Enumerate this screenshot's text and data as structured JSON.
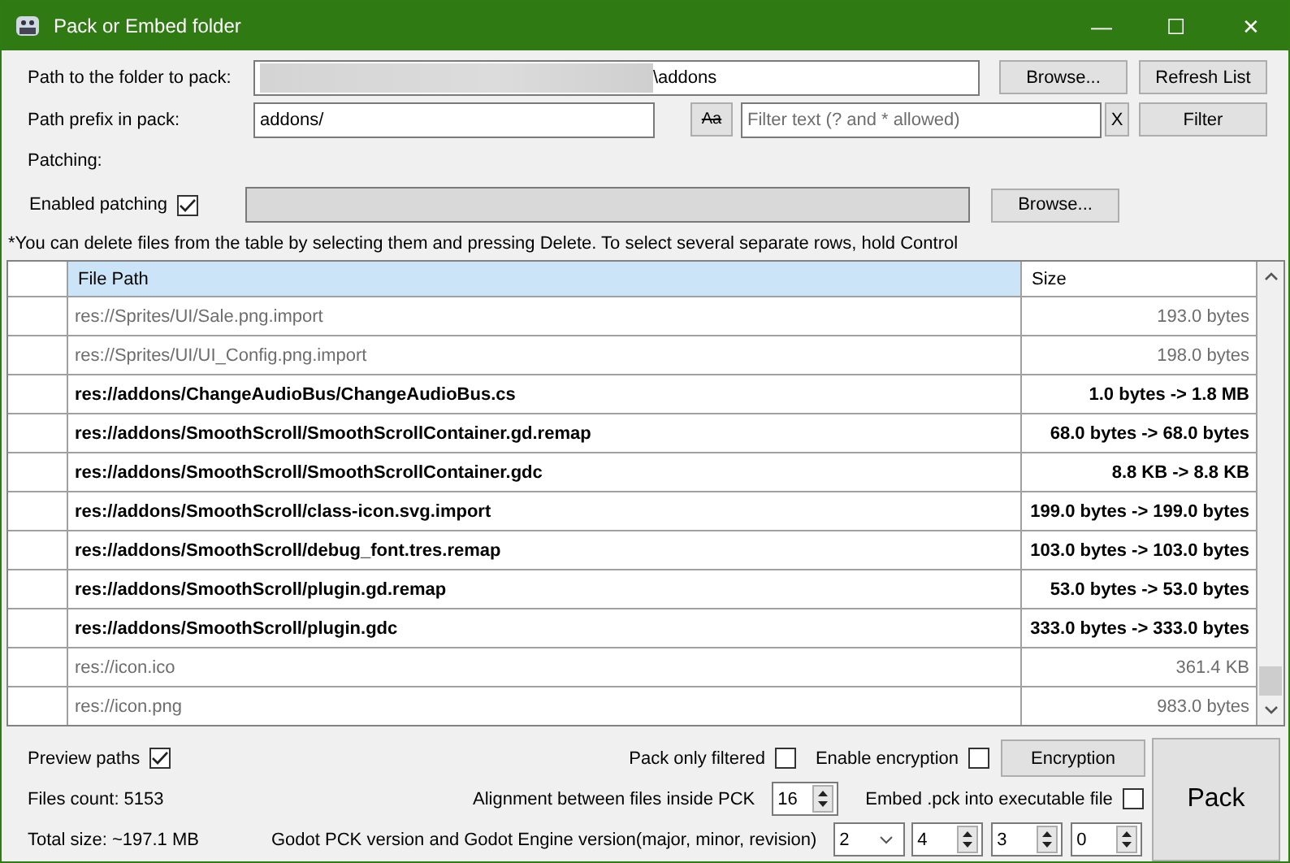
{
  "window": {
    "title": "Pack or Embed folder",
    "controls": [
      "—",
      "☐",
      "✕"
    ]
  },
  "folder": {
    "label": "Path to the folder to pack:",
    "value": "\\addons",
    "browse": "Browse...",
    "refresh": "Refresh List"
  },
  "prefix": {
    "label": "Path prefix in pack:",
    "value": "addons/",
    "case_button": "Aa",
    "filter_placeholder": "Filter text (? and * allowed)",
    "clear": "X",
    "filter": "Filter"
  },
  "patching": {
    "heading": "Patching:",
    "label": "Enabled patching",
    "checked": true,
    "browse": "Browse..."
  },
  "note": "*You can delete files from the table by selecting them and pressing Delete. To select several separate rows, hold Control",
  "table": {
    "columns": [
      "File Path",
      "Size"
    ],
    "rows": [
      {
        "path": "res://Sprites/UI/Sale.png.import",
        "size": "193.0 bytes",
        "patched": false
      },
      {
        "path": "res://Sprites/UI/UI_Config.png.import",
        "size": "198.0 bytes",
        "patched": false
      },
      {
        "path": "res://addons/ChangeAudioBus/ChangeAudioBus.cs",
        "size": "1.0 bytes -> 1.8 MB",
        "patched": true
      },
      {
        "path": "res://addons/SmoothScroll/SmoothScrollContainer.gd.remap",
        "size": "68.0 bytes -> 68.0 bytes",
        "patched": true
      },
      {
        "path": "res://addons/SmoothScroll/SmoothScrollContainer.gdc",
        "size": "8.8 KB -> 8.8 KB",
        "patched": true
      },
      {
        "path": "res://addons/SmoothScroll/class-icon.svg.import",
        "size": "199.0 bytes -> 199.0 bytes",
        "patched": true
      },
      {
        "path": "res://addons/SmoothScroll/debug_font.tres.remap",
        "size": "103.0 bytes -> 103.0 bytes",
        "patched": true
      },
      {
        "path": "res://addons/SmoothScroll/plugin.gd.remap",
        "size": "53.0 bytes -> 53.0 bytes",
        "patched": true
      },
      {
        "path": "res://addons/SmoothScroll/plugin.gdc",
        "size": "333.0 bytes -> 333.0 bytes",
        "patched": true
      },
      {
        "path": "res://icon.ico",
        "size": "361.4 KB",
        "patched": false
      },
      {
        "path": "res://icon.png",
        "size": "983.0 bytes",
        "patched": false
      }
    ]
  },
  "options": {
    "preview": {
      "label": "Preview paths",
      "checked": true
    },
    "files_count": "Files count: 5153",
    "total_size": "Total size: ~197.1 MB",
    "pack_only_filtered": {
      "label": "Pack only filtered",
      "checked": false
    },
    "encryption": {
      "label": "Enable encryption",
      "checked": false
    },
    "encryption_button": "Encryption",
    "alignment": {
      "label": "Alignment between files inside PCK",
      "value": "16"
    },
    "embed": {
      "label": "Embed .pck into executable file",
      "checked": false
    },
    "version": {
      "label": "Godot PCK version and Godot Engine version(major, minor, revision)",
      "pck": "2",
      "major": "4",
      "minor": "3",
      "revision": "0"
    },
    "pack": "Pack"
  }
}
